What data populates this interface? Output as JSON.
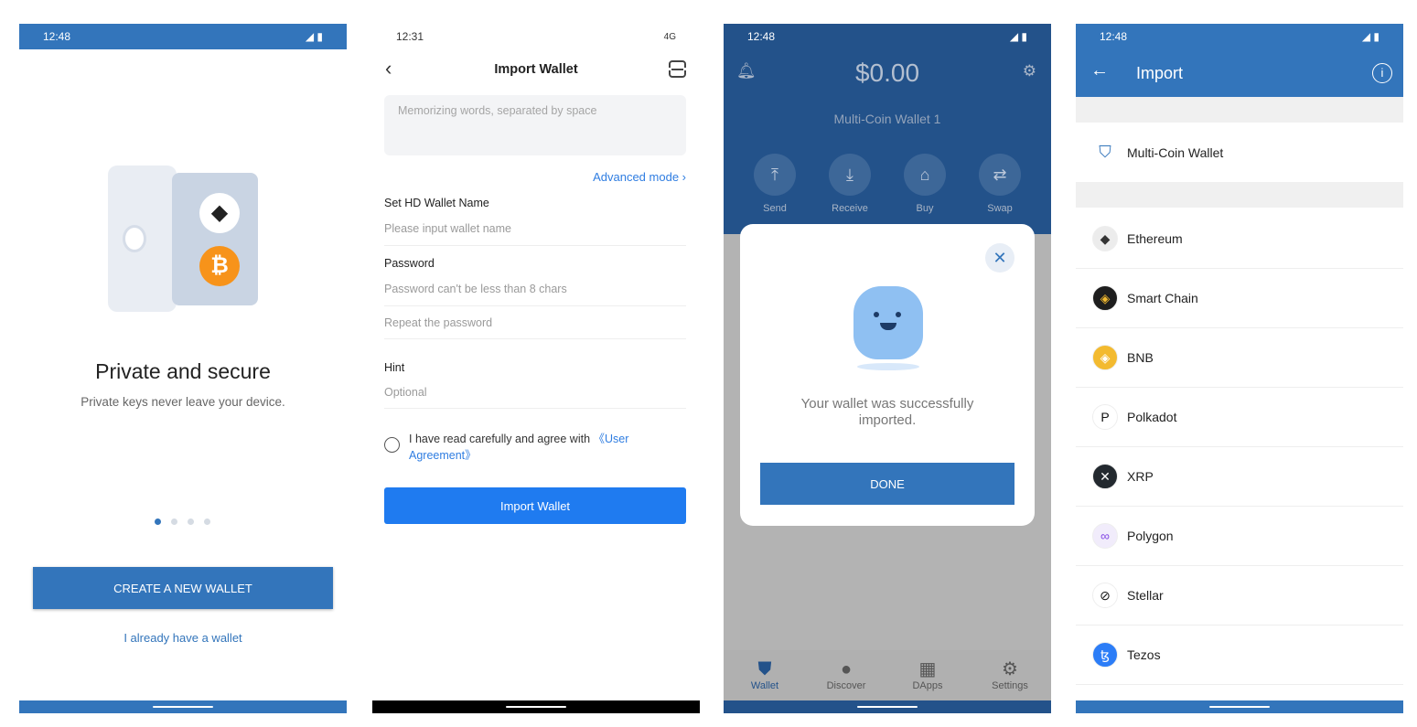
{
  "colors": {
    "brand": "#3375bb",
    "link": "#2f7de1",
    "button2": "#1f7bf0"
  },
  "screen1": {
    "status_time": "12:48",
    "title": "Private and secure",
    "subtitle": "Private keys never leave your device.",
    "pager": {
      "count": 4,
      "active": 0
    },
    "create_button": "CREATE A NEW WALLET",
    "existing_link": "I already have a wallet"
  },
  "screen2": {
    "status_time": "12:31",
    "network": "4G",
    "title": "Import Wallet",
    "phrase_placeholder": "Memorizing words, separated by space",
    "advanced_mode": "Advanced mode",
    "name_label": "Set HD Wallet Name",
    "name_placeholder": "Please input wallet name",
    "password_label": "Password",
    "password_placeholder": "Password can't be less than 8 chars",
    "repeat_placeholder": "Repeat the password",
    "hint_label": "Hint",
    "hint_placeholder": "Optional",
    "agree_text": "I have read carefully and agree with ",
    "agree_link": "《User Agreement》",
    "import_button": "Import Wallet"
  },
  "screen3": {
    "status_time": "12:48",
    "balance": "$0.00",
    "wallet_name": "Multi-Coin Wallet 1",
    "actions": [
      {
        "label": "Send",
        "icon": "send-icon"
      },
      {
        "label": "Receive",
        "icon": "receive-icon"
      },
      {
        "label": "Buy",
        "icon": "tag-icon"
      },
      {
        "label": "Swap",
        "icon": "swap-icon"
      }
    ],
    "modal": {
      "message": "Your wallet was successfully imported.",
      "done": "DONE"
    },
    "tabs": [
      {
        "label": "Wallet",
        "active": true
      },
      {
        "label": "Discover"
      },
      {
        "label": "DApps"
      },
      {
        "label": "Settings"
      }
    ]
  },
  "screen4": {
    "status_time": "12:48",
    "title": "Import",
    "multi_coin": "Multi-Coin Wallet",
    "coins": [
      {
        "name": "Ethereum",
        "color": "#ececec",
        "glyph": "◆",
        "fg": "#333"
      },
      {
        "name": "Smart Chain",
        "color": "#1e1e1e",
        "glyph": "◈",
        "fg": "#f3ba2f"
      },
      {
        "name": "BNB",
        "color": "#f3ba2f",
        "glyph": "◈",
        "fg": "#fff"
      },
      {
        "name": "Polkadot",
        "color": "#fff",
        "glyph": "P",
        "fg": "#111"
      },
      {
        "name": "XRP",
        "color": "#23292f",
        "glyph": "✕",
        "fg": "#fff"
      },
      {
        "name": "Polygon",
        "color": "#f1ecfb",
        "glyph": "∞",
        "fg": "#8247e5"
      },
      {
        "name": "Stellar",
        "color": "#fff",
        "glyph": "⊘",
        "fg": "#111"
      },
      {
        "name": "Tezos",
        "color": "#2c7df7",
        "glyph": "ꜩ",
        "fg": "#fff"
      }
    ]
  }
}
